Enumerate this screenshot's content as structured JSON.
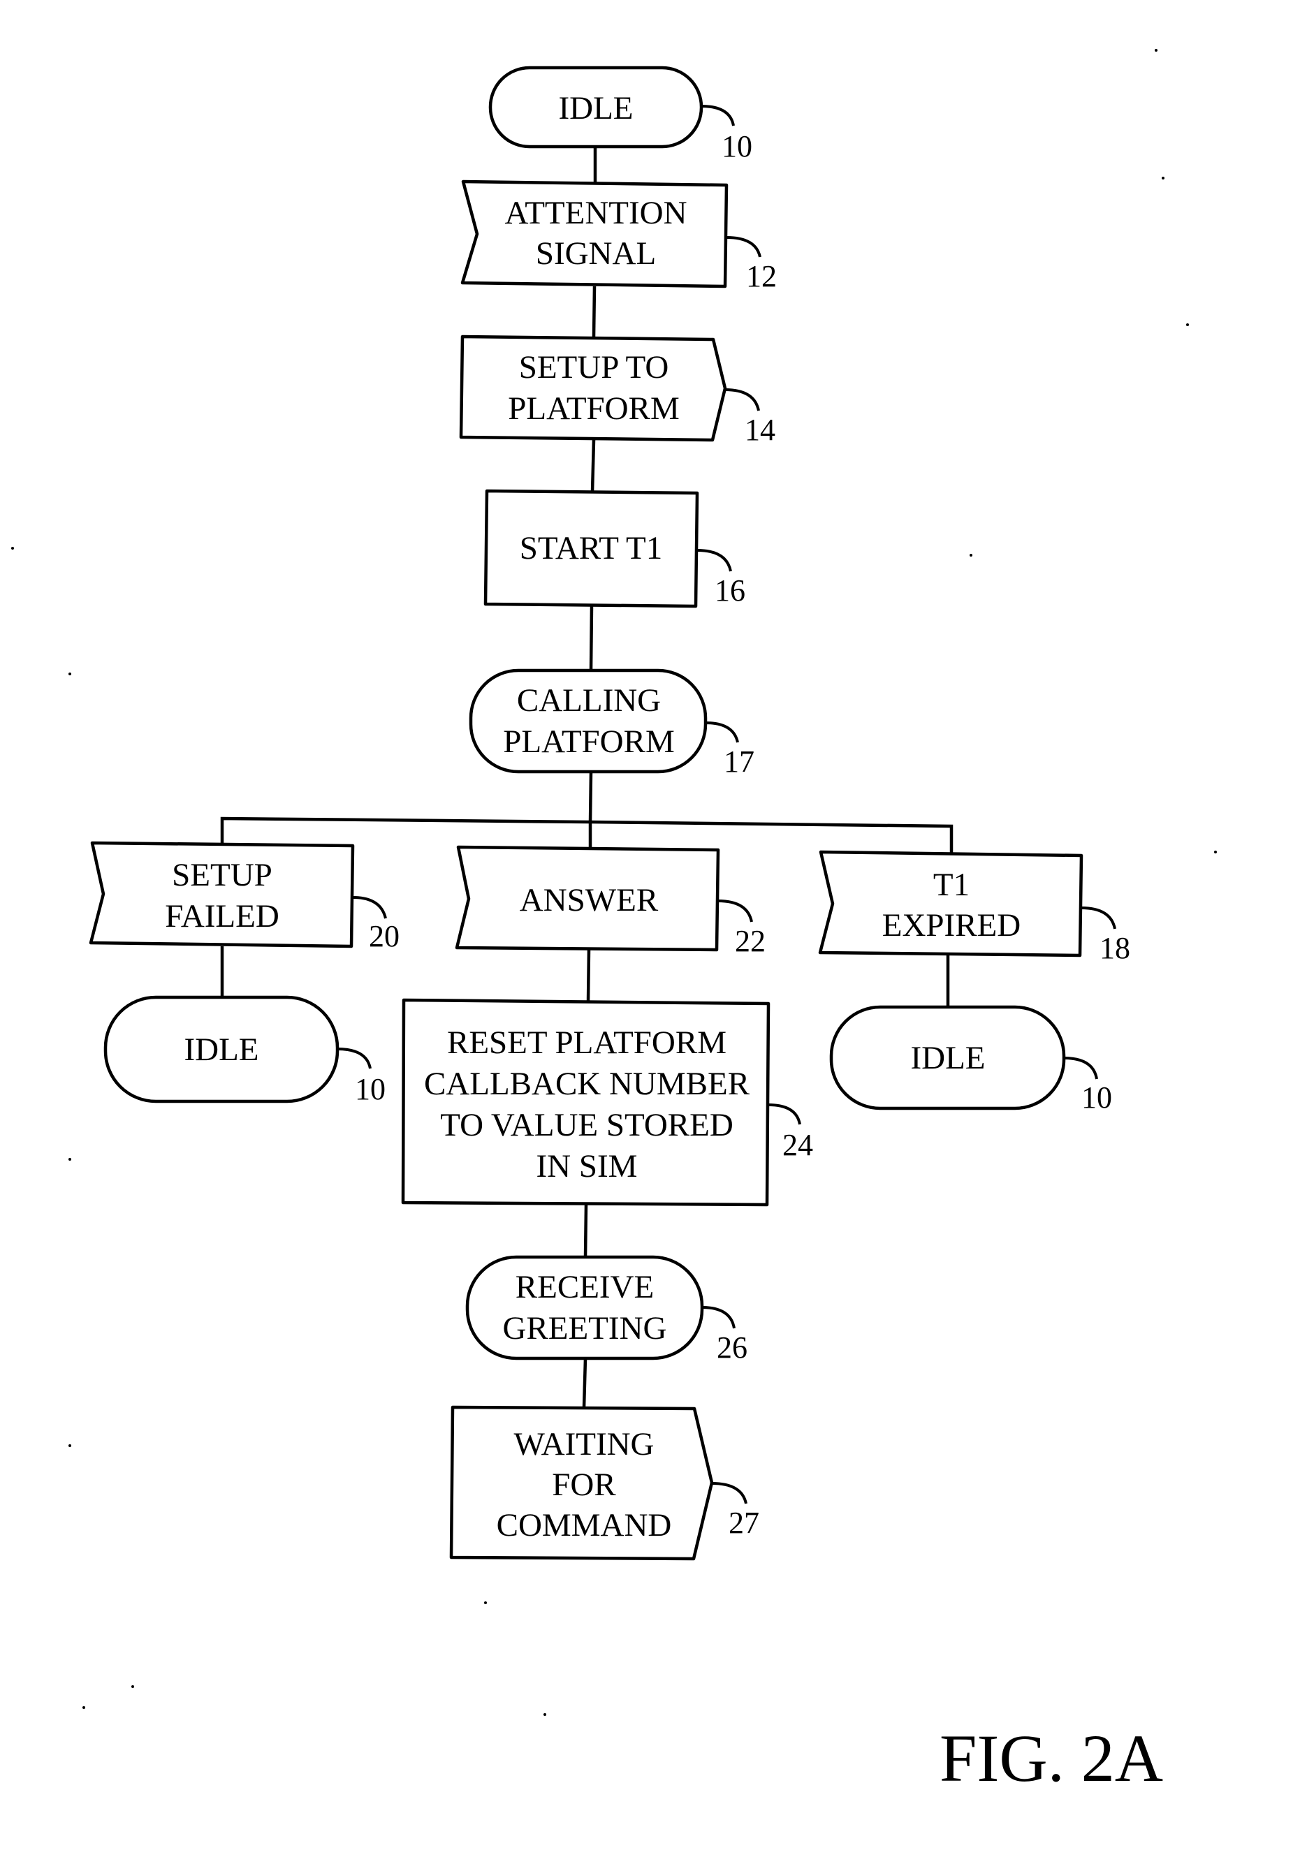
{
  "figure_label": "FIG. 2A",
  "nodes": {
    "idle_top": {
      "lines": [
        "IDLE"
      ],
      "ref": "10",
      "shape": "terminal"
    },
    "attention": {
      "lines": [
        "ATTENTION",
        "SIGNAL"
      ],
      "ref": "12",
      "shape": "signal-receive"
    },
    "setup_platform": {
      "lines": [
        "SETUP TO",
        "PLATFORM"
      ],
      "ref": "14",
      "shape": "signal-send"
    },
    "start_t1": {
      "lines": [
        "START T1"
      ],
      "ref": "16",
      "shape": "process"
    },
    "calling": {
      "lines": [
        "CALLING",
        "PLATFORM"
      ],
      "ref": "17",
      "shape": "terminal"
    },
    "setup_failed": {
      "lines": [
        "SETUP",
        "FAILED"
      ],
      "ref": "20",
      "shape": "signal-receive"
    },
    "answer": {
      "lines": [
        "ANSWER"
      ],
      "ref": "22",
      "shape": "signal-receive"
    },
    "t1_expired": {
      "lines": [
        "T1",
        "EXPIRED"
      ],
      "ref": "18",
      "shape": "signal-receive"
    },
    "idle_left": {
      "lines": [
        "IDLE"
      ],
      "ref": "10",
      "shape": "terminal"
    },
    "reset": {
      "lines": [
        "RESET PLATFORM",
        "CALLBACK NUMBER",
        "TO VALUE STORED",
        "IN SIM"
      ],
      "ref": "24",
      "shape": "process"
    },
    "idle_right": {
      "lines": [
        "IDLE"
      ],
      "ref": "10",
      "shape": "terminal"
    },
    "receive": {
      "lines": [
        "RECEIVE",
        "GREETING"
      ],
      "ref": "26",
      "shape": "terminal"
    },
    "waiting": {
      "lines": [
        "WAITING",
        "FOR",
        "COMMAND"
      ],
      "ref": "27",
      "shape": "signal-send"
    }
  },
  "edges": [
    [
      "idle_top",
      "attention"
    ],
    [
      "attention",
      "setup_platform"
    ],
    [
      "setup_platform",
      "start_t1"
    ],
    [
      "start_t1",
      "calling"
    ],
    [
      "calling",
      "setup_failed"
    ],
    [
      "calling",
      "answer"
    ],
    [
      "calling",
      "t1_expired"
    ],
    [
      "setup_failed",
      "idle_left"
    ],
    [
      "answer",
      "reset"
    ],
    [
      "t1_expired",
      "idle_right"
    ],
    [
      "reset",
      "receive"
    ],
    [
      "receive",
      "waiting"
    ]
  ]
}
